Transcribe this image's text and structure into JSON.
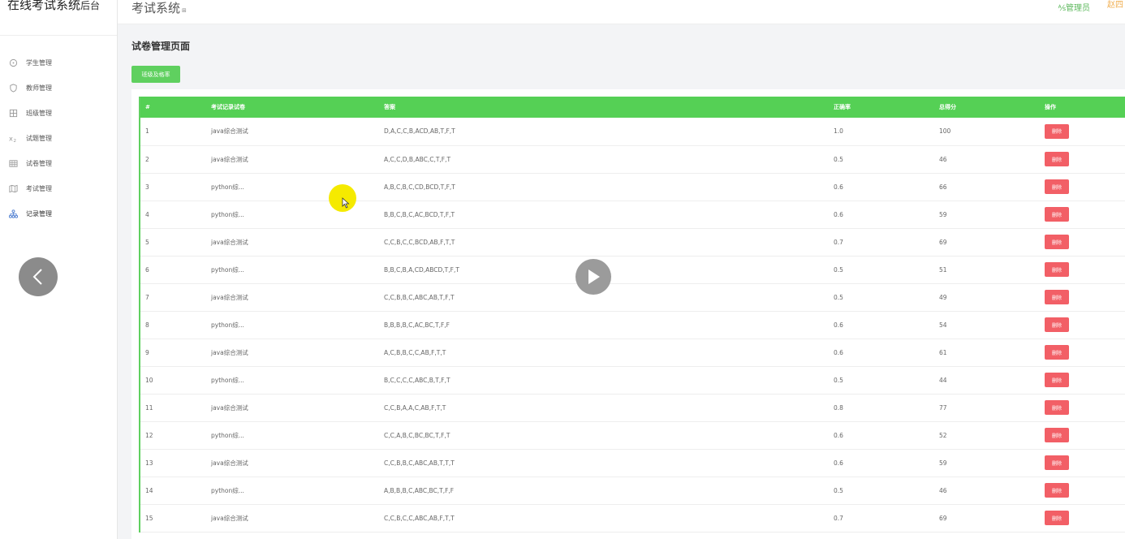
{
  "sidebar": {
    "brand_main": "在线考试系统",
    "brand_sub": "后台",
    "items": [
      {
        "label": "学生管理",
        "icon": "circle-icon"
      },
      {
        "label": "教师管理",
        "icon": "shield-icon"
      },
      {
        "label": "班级管理",
        "icon": "grid-icon"
      },
      {
        "label": "试题管理",
        "icon": "formula-icon"
      },
      {
        "label": "试卷管理",
        "icon": "table-icon"
      },
      {
        "label": "考试管理",
        "icon": "map-icon"
      },
      {
        "label": "记录管理",
        "icon": "sitemap-icon",
        "active": true
      }
    ]
  },
  "header": {
    "title": "考试系统",
    "title_mark": "⊞",
    "admin_label": "管理员",
    "user_name": "赵四"
  },
  "main": {
    "page_title": "试卷管理页面",
    "action_button": "班级及格率",
    "table": {
      "columns": [
        "#",
        "考试记录试卷",
        "答案",
        "正确率",
        "总得分",
        "操作"
      ],
      "delete_label": "删除",
      "rows": [
        [
          "1",
          "java综合测试",
          "D,A,C,C,B,ACD,AB,T,F,T",
          "1.0",
          "100"
        ],
        [
          "2",
          "java综合测试",
          "A,C,C,D,B,ABC,C,T,F,T",
          "0.5",
          "46"
        ],
        [
          "3",
          "python综...",
          "A,B,C,B,C,CD,BCD,T,F,T",
          "0.6",
          "66"
        ],
        [
          "4",
          "python综...",
          "B,B,C,B,C,AC,BCD,T,F,T",
          "0.6",
          "59"
        ],
        [
          "5",
          "java综合测试",
          "C,C,B,C,C,BCD,AB,F,T,T",
          "0.7",
          "69"
        ],
        [
          "6",
          "python综...",
          "B,B,C,B,A,CD,ABCD,T,F,T",
          "0.5",
          "51"
        ],
        [
          "7",
          "java综合测试",
          "C,C,B,B,C,ABC,AB,T,F,T",
          "0.5",
          "49"
        ],
        [
          "8",
          "python综...",
          "B,B,B,B,C,AC,BC,T,F,F",
          "0.6",
          "54"
        ],
        [
          "9",
          "java综合测试",
          "A,C,B,B,C,C,AB,F,T,T",
          "0.6",
          "61"
        ],
        [
          "10",
          "python综...",
          "B,C,C,C,C,ABC,B,T,F,T",
          "0.5",
          "44"
        ],
        [
          "11",
          "java综合测试",
          "C,C,B,A,A,C,AB,F,T,T",
          "0.8",
          "77"
        ],
        [
          "12",
          "python综...",
          "C,C,A,B,C,BC,BC,T,F,T",
          "0.6",
          "52"
        ],
        [
          "13",
          "java综合测试",
          "C,C,B,B,C,ABC,AB,T,T,T",
          "0.6",
          "59"
        ],
        [
          "14",
          "python综...",
          "A,B,B,B,C,ABC,BC,T,F,F",
          "0.5",
          "46"
        ],
        [
          "15",
          "java综合测试",
          "C,C,B,C,C,ABC,AB,F,T,T",
          "0.7",
          "69"
        ]
      ]
    }
  },
  "colors": {
    "accent_green": "#55d055",
    "delete_red": "#f25f66",
    "admin_green": "#5cb85c",
    "user_orange": "#f0ad4e"
  }
}
